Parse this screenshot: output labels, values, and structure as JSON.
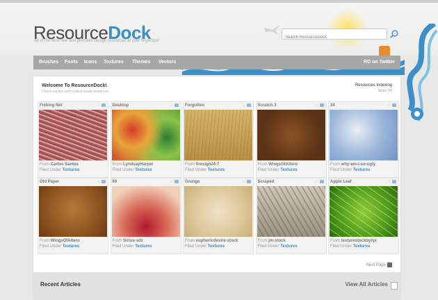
{
  "site": {
    "logo_part1": "Resource",
    "logo_part2": "Dock",
    "tagline": "All of the best free and premium design resources at your fingertips!"
  },
  "search": {
    "placeholder": "Search ResourceDock"
  },
  "nav": {
    "items": [
      "Brushes",
      "Fonts",
      "Icons",
      "Textures",
      "Themes",
      "Vectors"
    ],
    "rss_label": "RD on Twitter"
  },
  "welcome": {
    "title": "Welcome To ResourceDock!",
    "subtitle": "Check out the web's latest visual resources.",
    "indexing_title": "Resources Indexing",
    "indexing_sub": "Since '08"
  },
  "cards": [
    {
      "title": "Fishing Net",
      "from_label": "From",
      "author": "Carlos Santos",
      "filed_label": "Filed Under",
      "category": "Textures",
      "tex": "fishing"
    },
    {
      "title": "Desktop",
      "from_label": "From",
      "author": "LyndsayHarper",
      "filed_label": "Filed Under",
      "category": "Textures",
      "tex": "desktop"
    },
    {
      "title": "Forgotten",
      "from_label": "From",
      "author": "firesign24-7",
      "filed_label": "Filed Under",
      "category": "Textures",
      "tex": "forgotten"
    },
    {
      "title": "Scratch 3",
      "from_label": "From",
      "author": "WingsOfAltero",
      "filed_label": "Filed Under",
      "category": "Textures",
      "tex": "scratch"
    },
    {
      "title": "34",
      "from_label": "From",
      "author": "why-am-i-so-ugly",
      "filed_label": "Filed Under",
      "category": "Textures",
      "tex": "blue"
    },
    {
      "title": "Old Paper",
      "from_label": "From",
      "author": "WingsOfAltero",
      "filed_label": "Filed Under",
      "category": "Textures",
      "tex": "oldpaper"
    },
    {
      "title": "69",
      "from_label": "From",
      "author": "Sirius-sdz",
      "filed_label": "Filed Under",
      "category": "Textures",
      "tex": "red"
    },
    {
      "title": "Grunge",
      "from_label": "From",
      "author": "euphoricdesire-stock",
      "filed_label": "Filed Under",
      "category": "Textures",
      "tex": "grunge"
    },
    {
      "title": "Scraped",
      "from_label": "From",
      "author": "jm-stock",
      "filed_label": "Filed Under",
      "category": "Textures",
      "tex": "scraped"
    },
    {
      "title": "Apple Leaf",
      "from_label": "From",
      "author": "texturestockbyhjx",
      "filed_label": "Filed Under",
      "category": "Textures",
      "tex": "leaf"
    }
  ],
  "pagination": {
    "next_label": "Next Page"
  },
  "recent": {
    "title": "Recent Articles",
    "view_all": "View All Articles"
  },
  "colors": {
    "accent": "#3a8fc8",
    "nav_bg": "#a7a7a5",
    "rss": "#e88b2a"
  }
}
